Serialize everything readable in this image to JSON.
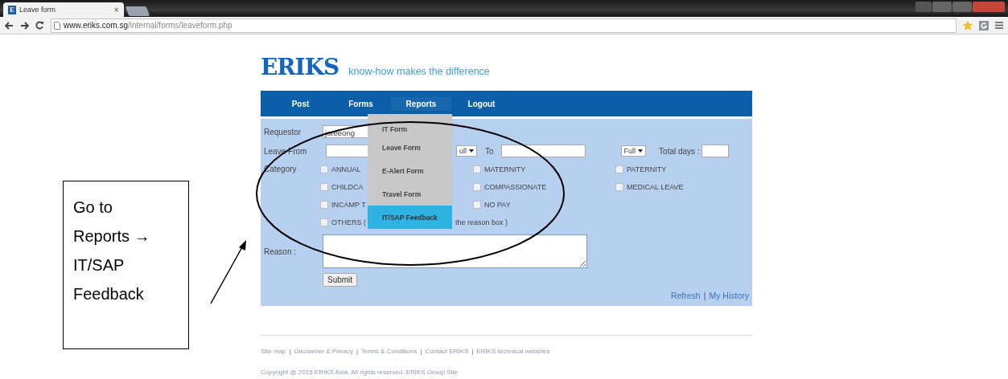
{
  "browser": {
    "favicon": "E",
    "tab_title": "Leave form",
    "tab_close": "×",
    "url_host": "www.eriks.com.sg",
    "url_path": "/internal/forms/leaveform.php"
  },
  "header": {
    "logo": "ERIKS",
    "tagline": "know-how makes the difference"
  },
  "nav": {
    "items": [
      {
        "label": "Post",
        "selected": false
      },
      {
        "label": "Forms",
        "selected": false
      },
      {
        "label": "Reports",
        "selected": true
      },
      {
        "label": "Logout",
        "selected": false
      }
    ]
  },
  "dropdown": {
    "items": [
      {
        "label": "IT Form",
        "selected": false
      },
      {
        "label": "Leave Form",
        "selected": false
      },
      {
        "label": "E-Alert Form",
        "selected": false
      },
      {
        "label": "Travel Form",
        "selected": false
      },
      {
        "label": "IT/SAP Feedback",
        "selected": true
      }
    ]
  },
  "form": {
    "requestor": {
      "label": "Requestor",
      "value": "joreeong"
    },
    "leave_from": {
      "label": "Leave From",
      "from_session": "ull",
      "to_label": "To",
      "to_session": "Full",
      "total_label": "Total days :"
    },
    "category": {
      "label": "Category",
      "options": [
        {
          "label": "ANNUAL",
          "checked": false
        },
        {
          "label": "MATERNITY",
          "checked": false
        },
        {
          "label": "PATERNITY",
          "checked": false
        },
        {
          "label": "CHILDCA",
          "checked": false
        },
        {
          "label": "COMPASSIONATE",
          "checked": false
        },
        {
          "label": "MEDICAL LEAVE",
          "checked": false
        },
        {
          "label": "INCAMP T",
          "checked": false
        },
        {
          "label": "NO PAY",
          "checked": false
        },
        {
          "label": "OTHERS (",
          "checked": false,
          "tail": "the reason box )"
        }
      ]
    },
    "reason": {
      "label": "Reason :"
    },
    "submit": "Submit",
    "links": [
      {
        "kind": "link",
        "text": "Refresh"
      },
      {
        "kind": "separator",
        "text": "|"
      },
      {
        "kind": "link",
        "text": "My History"
      }
    ]
  },
  "footer": {
    "links": [
      {
        "kind": "link",
        "text": "Site map"
      },
      {
        "kind": "separator",
        "text": "|"
      },
      {
        "kind": "link",
        "text": "Disclaimer & Privacy"
      },
      {
        "kind": "separator",
        "text": "|"
      },
      {
        "kind": "link",
        "text": "Terms & Conditions"
      },
      {
        "kind": "separator",
        "text": "|"
      },
      {
        "kind": "link",
        "text": "Contact ERIKS"
      },
      {
        "kind": "separator",
        "text": "|"
      },
      {
        "kind": "link",
        "text": "ERIKS technical websites"
      }
    ],
    "copyright": "Copyright @ 2015 ERIKS Asia. All rights reserved. ERIKS Group Site"
  },
  "annotation": {
    "callout": "Go to Reports → IT/SAP Feedback"
  }
}
